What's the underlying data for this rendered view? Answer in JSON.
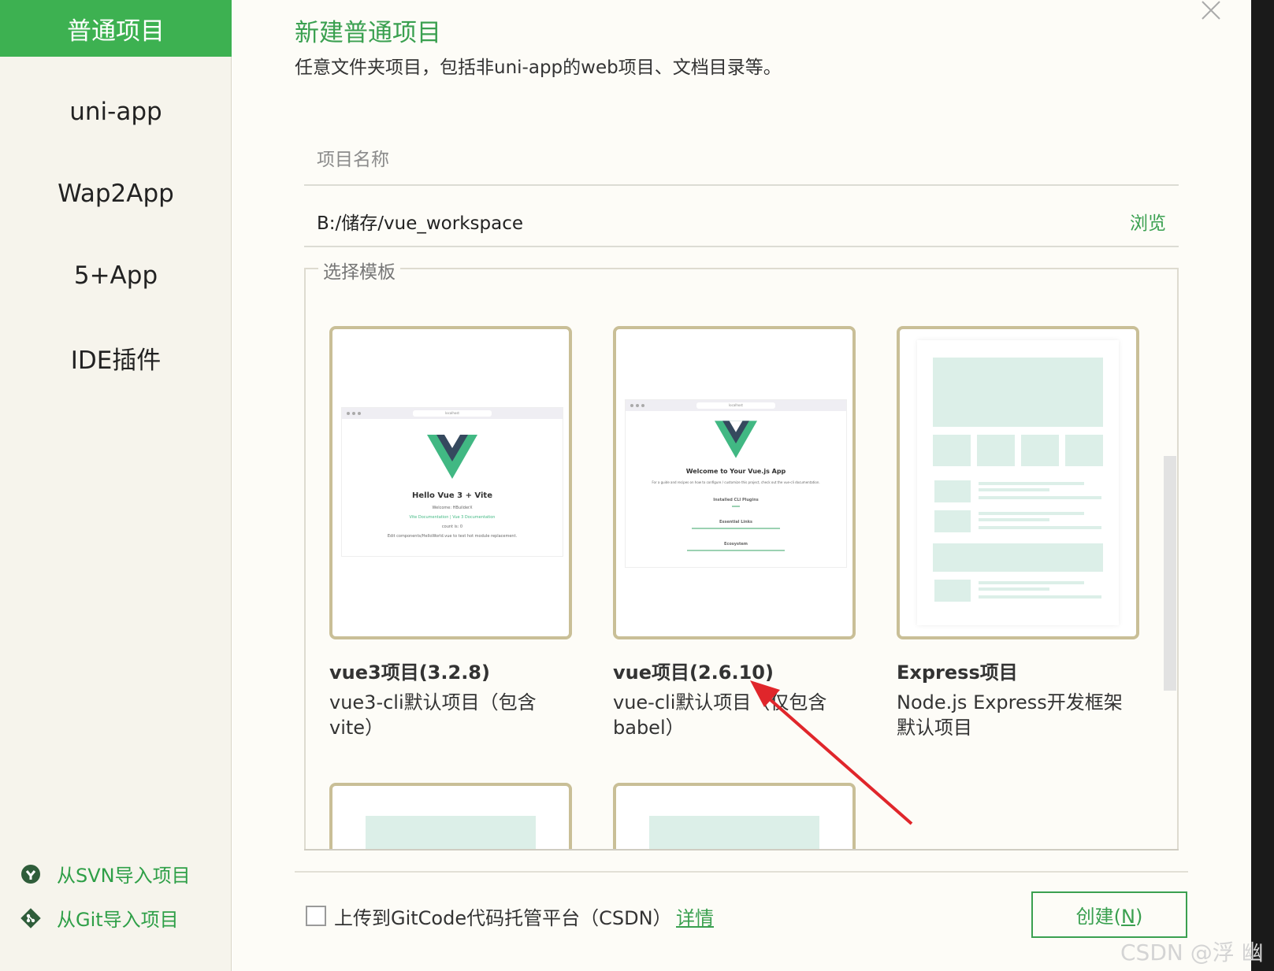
{
  "sidebar": {
    "items": [
      {
        "label": "普通项目",
        "active": true
      },
      {
        "label": "uni-app"
      },
      {
        "label": "Wap2App"
      },
      {
        "label": "5+App"
      },
      {
        "label": "IDE插件"
      }
    ],
    "svn_import": "从SVN导入项目",
    "git_import": "从Git导入项目"
  },
  "dialog": {
    "title": "新建普通项目",
    "subtitle": "任意文件夹项目，包括非uni-app的web项目、文档目录等。"
  },
  "form": {
    "project_name_placeholder": "项目名称",
    "project_name_value": "",
    "location_value": "B:/储存/vue_workspace",
    "browse_label": "浏览"
  },
  "templates": {
    "legend": "选择模板",
    "cards": [
      {
        "name": "vue3项目(3.2.8)",
        "desc": "vue3-cli默认项目（包含vite）",
        "preview": {
          "url": "localhost",
          "heading": "Hello Vue 3 + Vite",
          "line1": "Welcome: HBuilderX",
          "line2": "Vite Documentation | Vue 3 Documentation",
          "line3": "count is: 0",
          "line4": "Edit components/HelloWorld.vue to test hot module replacement."
        }
      },
      {
        "name": "vue项目(2.6.10)",
        "desc": "vue-cli默认项目（仅包含babel）",
        "preview": {
          "url": "localhost",
          "heading": "Welcome to Your Vue.js App",
          "line1": "For a guide and recipes on how to configure / customize this project, check out the vue-cli documentation.",
          "sec1": "Installed CLI Plugins",
          "sec2": "Essential Links",
          "sec3": "Ecosystem"
        }
      },
      {
        "name": "Express项目",
        "desc": "Node.js Express开发框架默认项目"
      }
    ]
  },
  "footer": {
    "upload_label": "上传到GitCode代码托管平台（CSDN）",
    "upload_checked": false,
    "detail_link": "详情",
    "create_label": "创建(",
    "create_key": "N",
    "create_close": ")"
  },
  "watermark": "CSDN @浮 幽",
  "colors": {
    "accent": "#3db151",
    "link": "#3aa050",
    "card_border": "#c9bf97",
    "sidebar_bg": "#f6f4ec",
    "annotation_arrow": "#e0262b"
  }
}
